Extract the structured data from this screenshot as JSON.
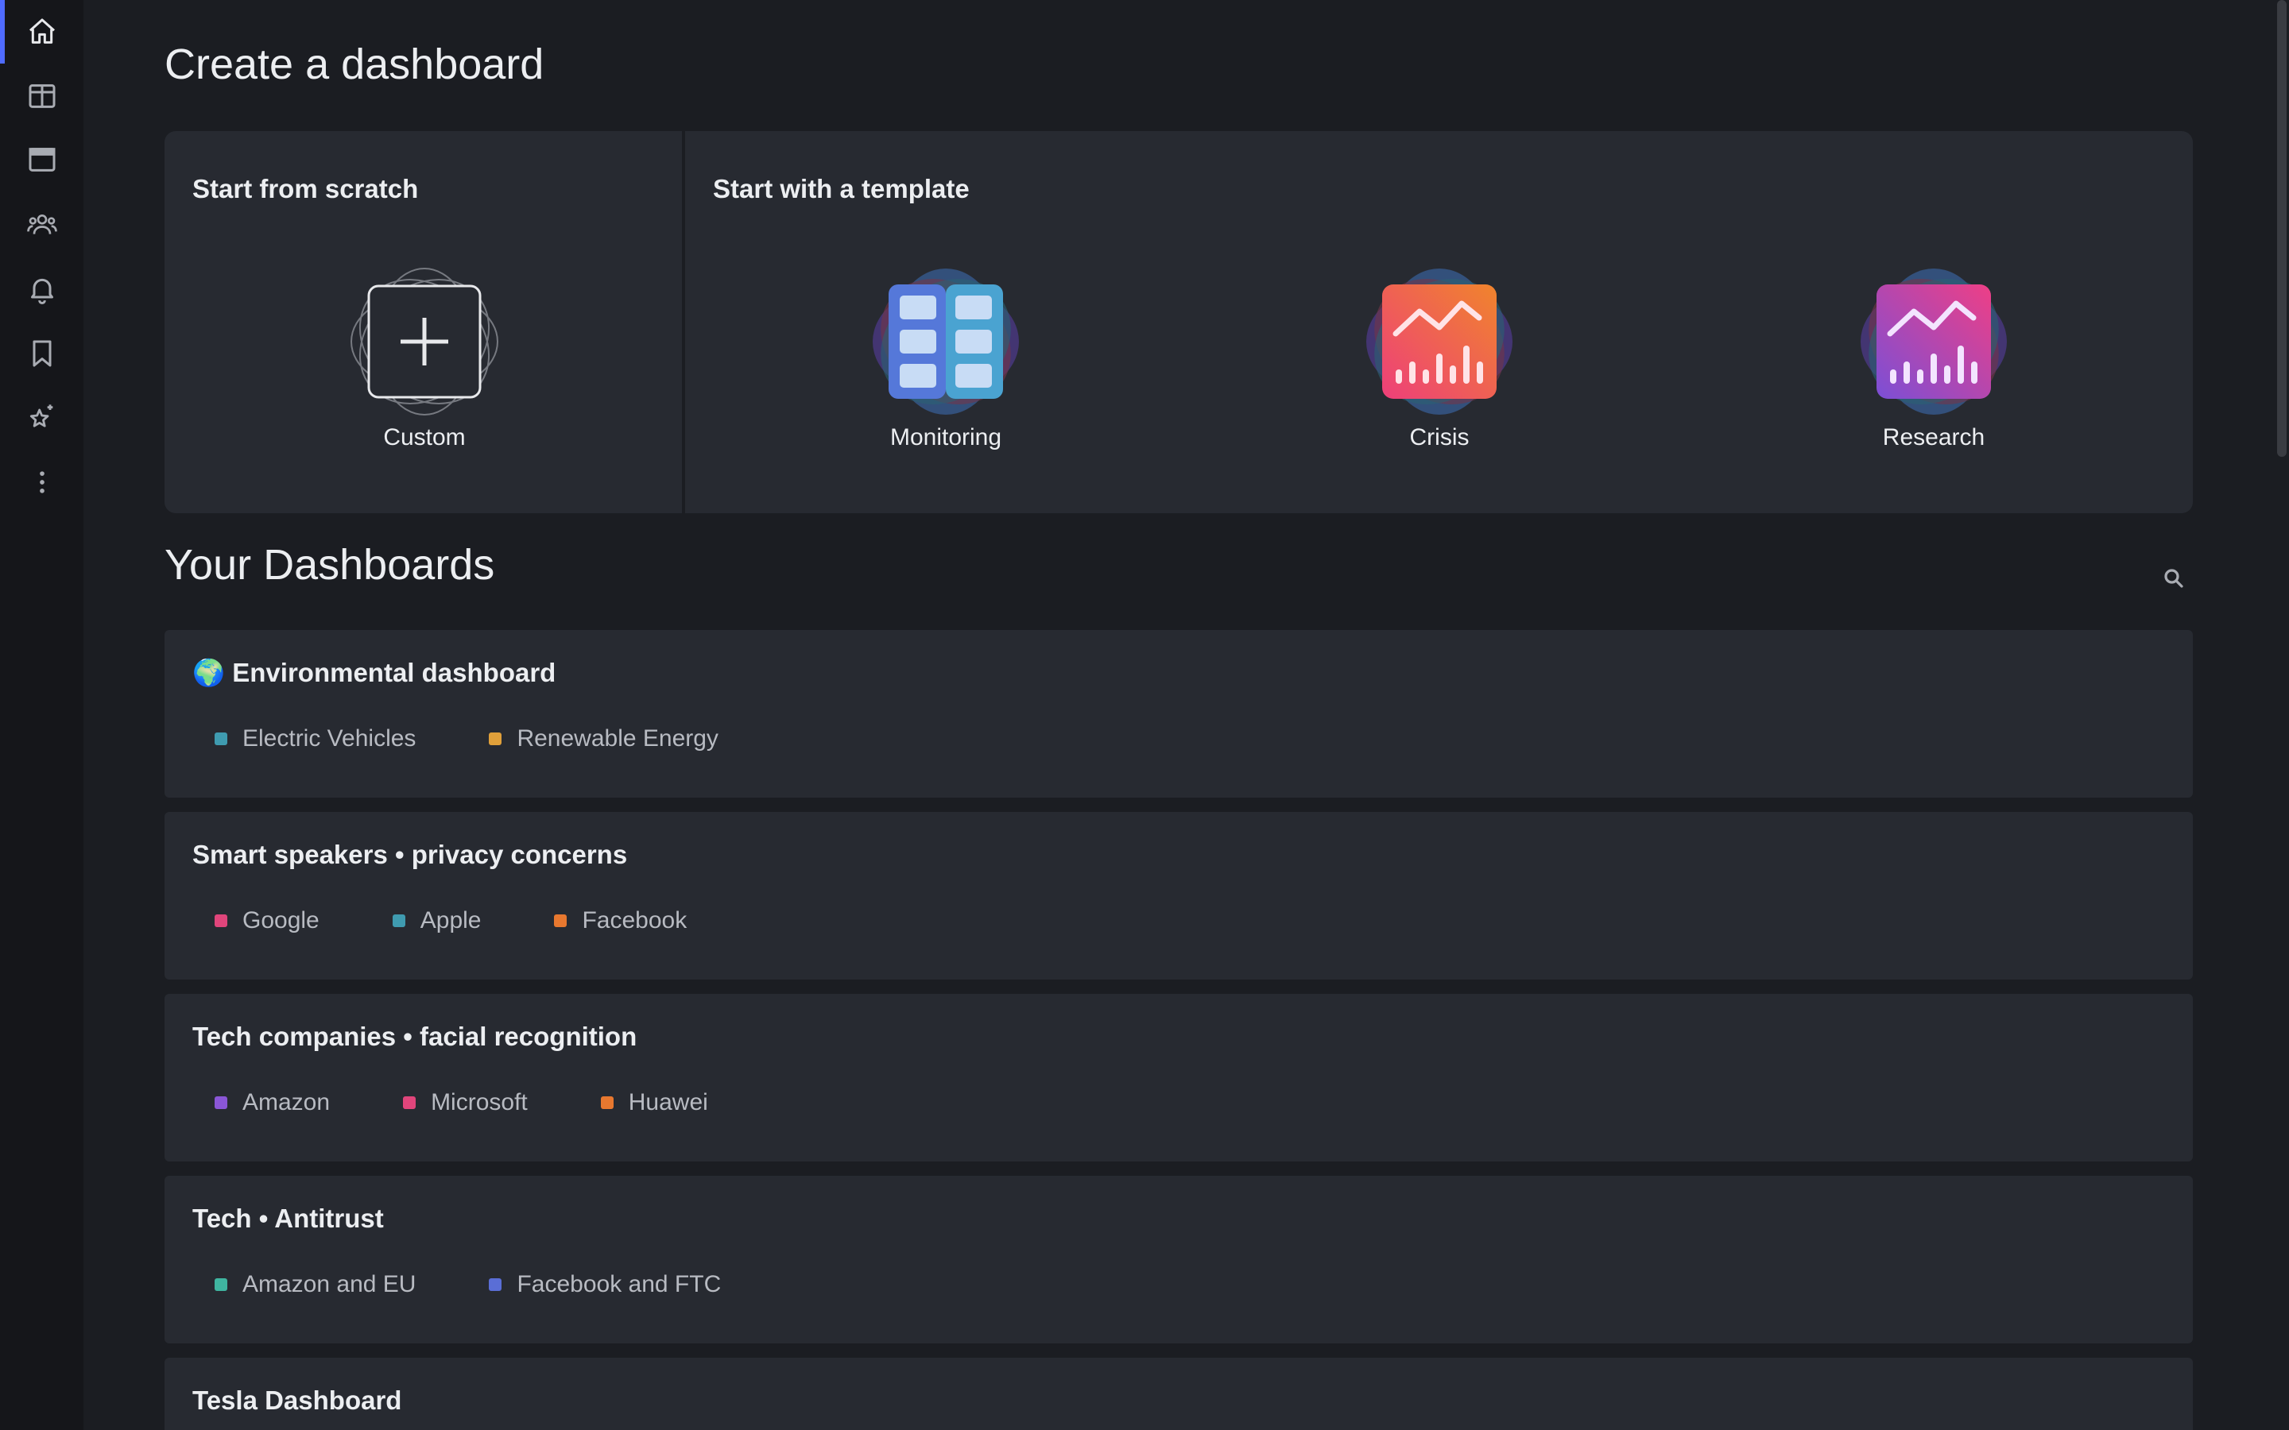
{
  "sidebar": {
    "items": [
      {
        "name": "home-icon",
        "active": true
      },
      {
        "name": "panels-icon"
      },
      {
        "name": "window-icon"
      },
      {
        "name": "users-icon"
      },
      {
        "name": "bell-icon"
      },
      {
        "name": "bookmark-icon"
      },
      {
        "name": "sparkle-star-icon"
      },
      {
        "name": "more-vertical-icon"
      }
    ],
    "accent": "#4f6bff"
  },
  "page": {
    "title": "Create a dashboard"
  },
  "create": {
    "scratch_heading": "Start from scratch",
    "template_heading": "Start with a template",
    "templates": [
      {
        "label": "Custom",
        "icon": "plus-icon"
      },
      {
        "label": "Monitoring",
        "icon": "monitoring-grid-icon"
      },
      {
        "label": "Crisis",
        "icon": "crisis-chart-icon"
      },
      {
        "label": "Research",
        "icon": "research-chart-icon"
      }
    ]
  },
  "dashboards": {
    "title": "Your Dashboards",
    "search_icon": "search-icon",
    "items": [
      {
        "emoji": "🌍",
        "title": "Environmental dashboard",
        "tags": [
          {
            "label": "Electric Vehicles",
            "color": "#3f9bb0"
          },
          {
            "label": "Renewable Energy",
            "color": "#e0a03a"
          }
        ]
      },
      {
        "emoji": "",
        "title": "Smart speakers • privacy concerns",
        "tags": [
          {
            "label": "Google",
            "color": "#e0457b"
          },
          {
            "label": "Apple",
            "color": "#3f9bb0"
          },
          {
            "label": "Facebook",
            "color": "#e8782f"
          }
        ]
      },
      {
        "emoji": "",
        "title": "Tech companies • facial recognition",
        "tags": [
          {
            "label": "Amazon",
            "color": "#8a56d6"
          },
          {
            "label": "Microsoft",
            "color": "#e0457b"
          },
          {
            "label": "Huawei",
            "color": "#e8782f"
          }
        ]
      },
      {
        "emoji": "",
        "title": "Tech • Antitrust",
        "tags": [
          {
            "label": "Amazon and EU",
            "color": "#3fb5a0"
          },
          {
            "label": "Facebook and FTC",
            "color": "#5a6ed6"
          }
        ]
      },
      {
        "emoji": "",
        "title": "Tesla Dashboard",
        "tags": []
      }
    ]
  }
}
